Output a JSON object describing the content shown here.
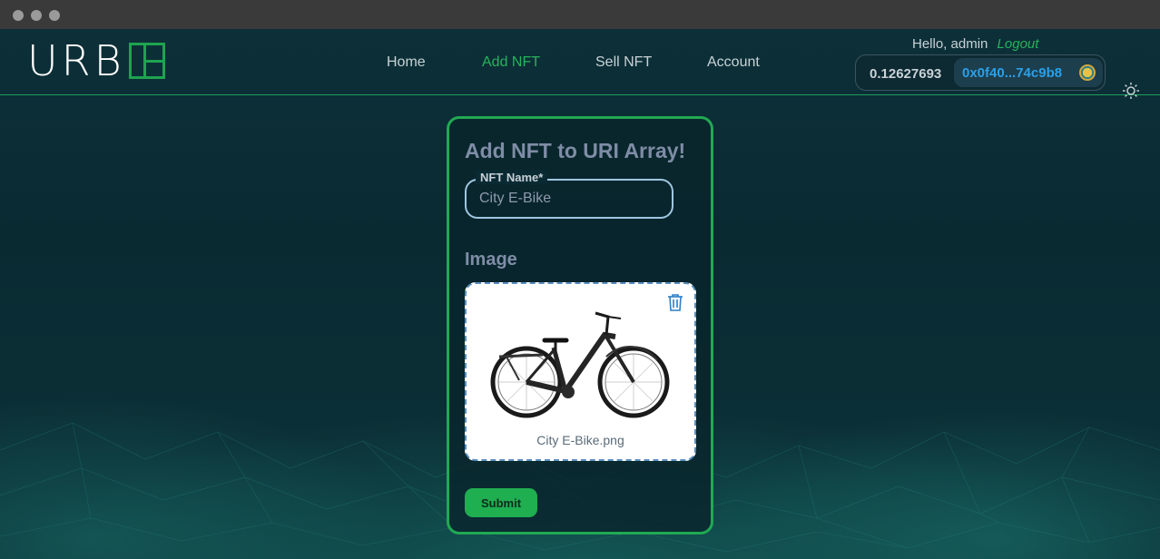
{
  "window": {
    "title": ""
  },
  "brand": {
    "logo_text": "URB"
  },
  "nav": {
    "items": [
      {
        "label": "Home",
        "active": false
      },
      {
        "label": "Add NFT",
        "active": true
      },
      {
        "label": "Sell NFT",
        "active": false
      },
      {
        "label": "Account",
        "active": false
      }
    ]
  },
  "user": {
    "greeting": "Hello, admin",
    "logout_label": "Logout",
    "balance": "0.12627693",
    "address": "0x0f40...74c9b8"
  },
  "form": {
    "title": "Add NFT to URI Array!",
    "name_label": "NFT Name*",
    "name_value": "City E-Bike",
    "image_label": "Image",
    "file_name": "City E-Bike.png",
    "submit_label": "Submit"
  },
  "icons": {
    "theme": "sun-icon",
    "delete": "trash-icon",
    "avatar": "wallet-avatar-icon"
  },
  "colors": {
    "accent": "#21a953",
    "link": "#2aa0e8",
    "background": "#0b2830"
  }
}
